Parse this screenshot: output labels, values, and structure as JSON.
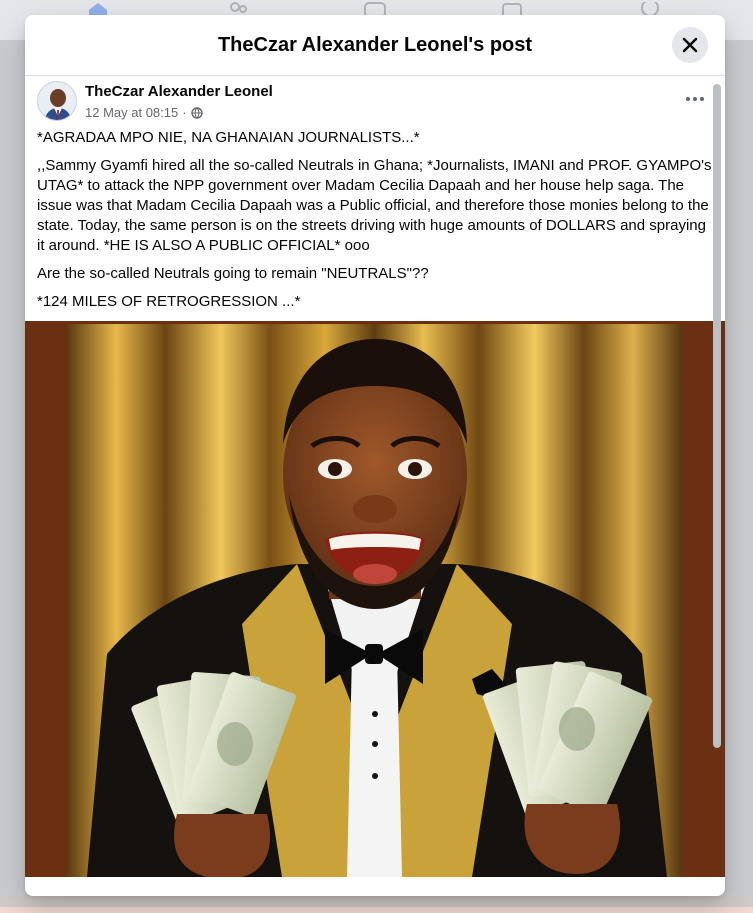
{
  "background_nav": {
    "icons": [
      "home-icon",
      "friends-icon",
      "watch-icon",
      "marketplace-icon",
      "gaming-icon"
    ]
  },
  "modal": {
    "title": "TheCzar Alexander Leonel's post",
    "close_icon": "close-icon"
  },
  "post": {
    "author": "TheCzar Alexander Leonel",
    "timestamp": "12 May at 08:15",
    "separator": "·",
    "privacy_icon": "globe-icon",
    "more_icon": "more-options-icon",
    "paragraphs": [
      "*AGRADAA MPO NIE, NA GHANAIAN JOURNALISTS...*",
      ",,Sammy Gyamfi hired all the so-called Neutrals in Ghana; *Journalists, IMANI and PROF. GYAMPO's UTAG* to attack the NPP government over Madam Cecilia Dapaah and her house help saga. The issue was that Madam Cecilia Dapaah was a Public official, and therefore those monies belong to the state. Today, the same person is on the streets driving with huge amounts of DOLLARS and spraying it around. *HE IS ALSO A PUBLIC OFFICIAL* ooo",
      "Are the so-called Neutrals going to remain \"NEUTRALS\"??",
      "*124 MILES OF RETROGRESSION ...*"
    ]
  },
  "colors": {
    "image_border": "#6b2f12",
    "accent_gold": "#c9a23a",
    "text_secondary": "#65676b"
  }
}
